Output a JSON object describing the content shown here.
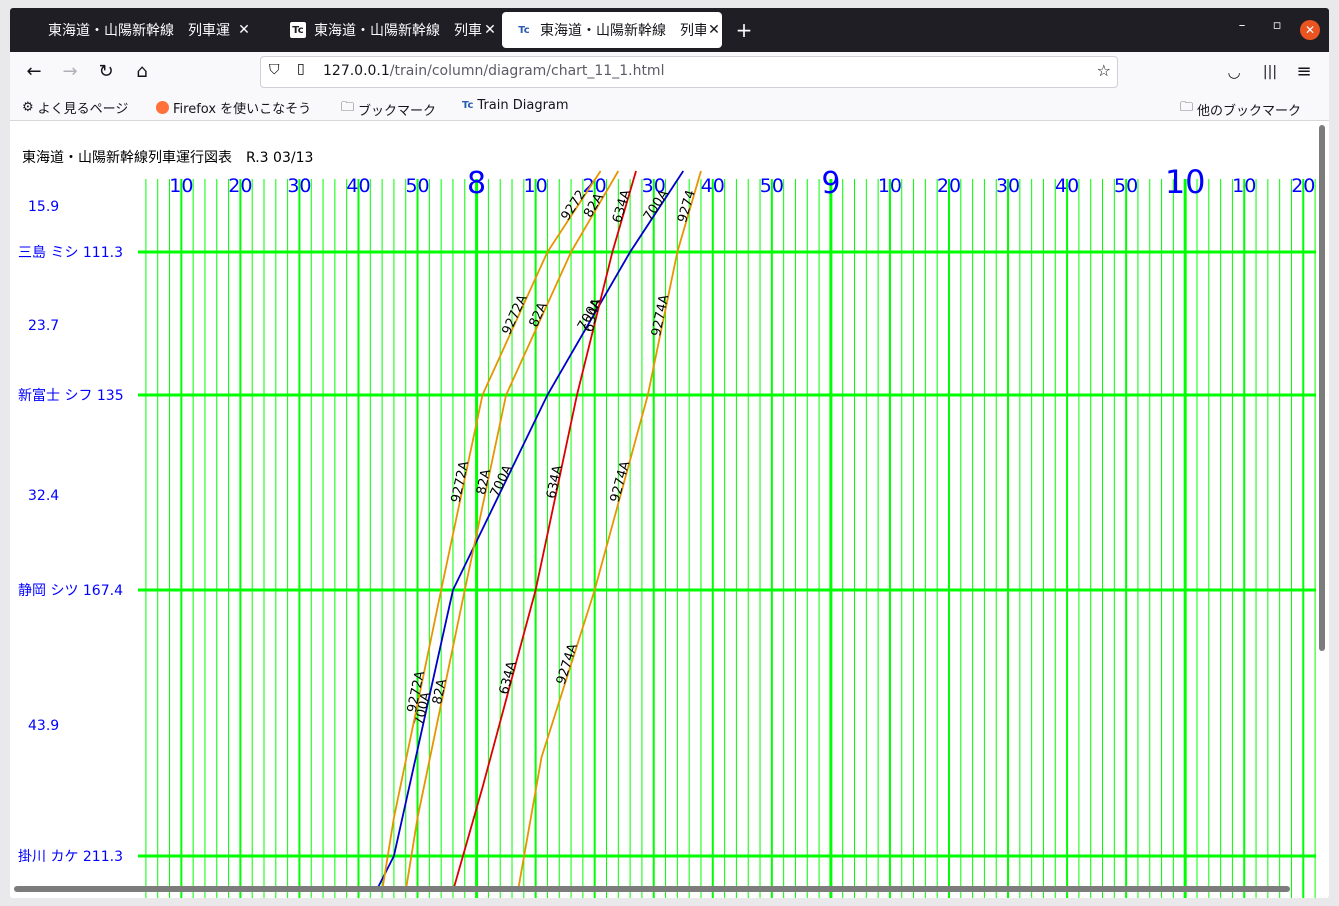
{
  "tabs": [
    {
      "label": "東海道・山陽新幹線　列車運",
      "icon": "blank-page-icon"
    },
    {
      "label": "東海道・山陽新幹線　列車運",
      "icon": "train-diagram-icon"
    },
    {
      "label": "東海道・山陽新幹線　列車運",
      "icon": "train-diagram-icon"
    }
  ],
  "address": {
    "host": "127.0.0.1",
    "path": "/train/column/diagram/chart_11_1.html"
  },
  "bookmarks": [
    {
      "label": "よく見るページ",
      "icon": "gear-icon"
    },
    {
      "label": "Firefox を使いこなそう",
      "icon": "firefox-icon"
    },
    {
      "label": "ブックマーク",
      "icon": "folder-icon"
    },
    {
      "label": "Train Diagram",
      "icon": "train-diagram-icon"
    }
  ],
  "other_bookmarks": "他のブックマーク",
  "page": {
    "title": "東海道・山陽新幹線列車運行図表　R.3 03/13"
  },
  "chart_data": {
    "type": "line",
    "title": "東海道・山陽新幹線列車運行図表　R.3 03/13",
    "x_axis": {
      "unit": "time (hour:minute)",
      "range": [
        "7:03",
        "10:22"
      ],
      "tick_labels": [
        "10",
        "20",
        "30",
        "40",
        "50",
        "8",
        "10",
        "20",
        "30",
        "40",
        "50",
        "9",
        "10",
        "20",
        "30",
        "40",
        "50",
        "10",
        "10",
        "20"
      ],
      "grid_minor_minutes": 2
    },
    "y_axis": {
      "unit": "km",
      "inverted": true,
      "stations": [
        {
          "name": "三島 ミシ",
          "km": 111.3
        },
        {
          "name": "新富士 シフ",
          "km": 135
        },
        {
          "name": "静岡 シツ",
          "km": 167.4
        },
        {
          "name": "掛川 カケ",
          "km": 211.3
        }
      ],
      "segment_distances": [
        {
          "label": "15.9",
          "between": [
            "",
            "三島"
          ]
        },
        {
          "label": "23.7",
          "between": [
            "三島",
            "新富士"
          ]
        },
        {
          "label": "32.4",
          "between": [
            "新富士",
            "静岡"
          ]
        },
        {
          "label": "43.9",
          "between": [
            "静岡",
            "掛川"
          ]
        }
      ]
    },
    "series": [
      {
        "name": "700A",
        "color": "#0000cc",
        "points": [
          [
            "8:35",
            95.4
          ],
          [
            "8:26",
            111.3
          ],
          [
            "8:12",
            135
          ],
          [
            "7:56",
            167.4
          ],
          [
            "7:46",
            211.3
          ],
          [
            "7:43",
            218
          ]
        ],
        "labels": [
          "700A",
          "700A",
          "700A",
          "700A"
        ]
      },
      {
        "name": "9272A",
        "color": "#e69500",
        "points": [
          [
            "8:21",
            95.4
          ],
          [
            "8:12",
            111.3
          ],
          [
            "8:01",
            135
          ],
          [
            "7:54",
            167.4
          ],
          [
            "7:46",
            205
          ],
          [
            "7:44",
            218
          ]
        ],
        "labels": [
          "9272",
          "9272A",
          "9272A",
          "9272A"
        ]
      },
      {
        "name": "82A",
        "color": "#e69500",
        "points": [
          [
            "8:24",
            95.4
          ],
          [
            "8:16",
            111.3
          ],
          [
            "8:05",
            135
          ],
          [
            "7:58",
            167.4
          ],
          [
            "7:50",
            205
          ],
          [
            "7:48",
            218
          ]
        ],
        "labels": [
          "82A",
          "82A",
          "82A",
          "82A"
        ]
      },
      {
        "name": "634A",
        "color": "#dd0000",
        "points": [
          [
            "8:27",
            95.4
          ],
          [
            "8:23",
            111.3
          ],
          [
            "8:17",
            135
          ],
          [
            "8:10",
            167.4
          ],
          [
            "8:01",
            200
          ],
          [
            "7:56",
            218
          ]
        ],
        "labels": [
          "634A",
          "634A",
          "634A",
          "634A"
        ]
      },
      {
        "name": "9274A",
        "color": "#e69500",
        "points": [
          [
            "8:38",
            95.4
          ],
          [
            "8:34",
            111.3
          ],
          [
            "8:29",
            135
          ],
          [
            "8:20",
            167.4
          ],
          [
            "8:11",
            195
          ],
          [
            "8:07",
            218
          ]
        ],
        "labels": [
          "9274",
          "9274A",
          "9274A",
          "9274A"
        ]
      }
    ],
    "grid": true
  }
}
